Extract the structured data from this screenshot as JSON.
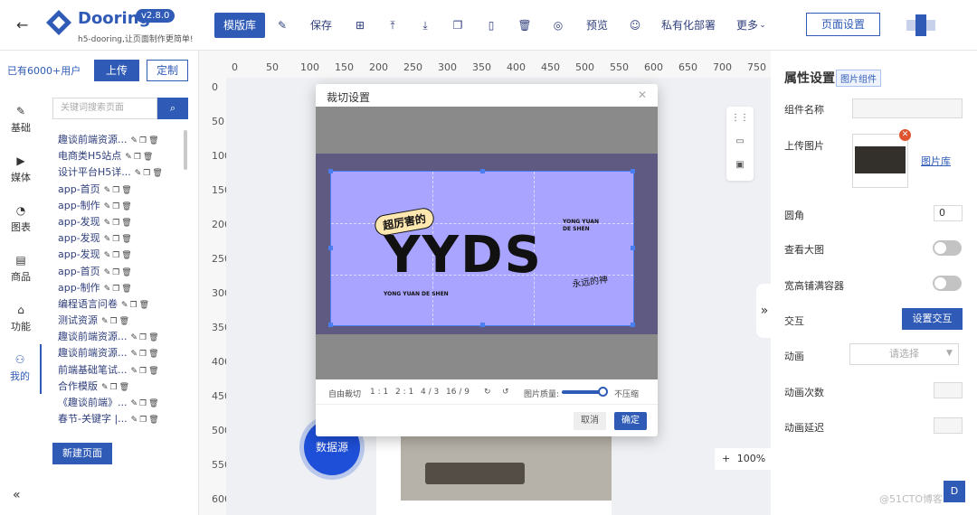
{
  "header": {
    "brand": "Dooring",
    "version": "v2.8.0",
    "slogan": "h5-dooring,让页面制作更简单!",
    "template_label": "模版库",
    "save_label": "保存",
    "preview_label": "预览",
    "private_deploy_label": "私有化部署",
    "more_label": "更多",
    "page_settings_label": "页面设置"
  },
  "left": {
    "users_text": "已有6000+用户",
    "upload_label": "上传",
    "custom_label": "定制",
    "search_placeholder": "关键词搜索页面",
    "nav": [
      {
        "label": "基础",
        "icon": "brush-icon"
      },
      {
        "label": "媒体",
        "icon": "play-icon"
      },
      {
        "label": "图表",
        "icon": "pie-chart-icon"
      },
      {
        "label": "商品",
        "icon": "shop-icon"
      },
      {
        "label": "功能",
        "icon": "function-icon"
      },
      {
        "label": "我的",
        "icon": "user-icon"
      }
    ],
    "pages": [
      "趣谈前端资源...",
      "电商类H5站点",
      "设计平台H5详...",
      "app-首页",
      "app-制作",
      "app-发现",
      "app-发现",
      "app-发现",
      "app-首页",
      "app-制作",
      "编程语言问卷",
      "测试资源",
      "趣谈前端资源...",
      "趣谈前端资源...",
      "前端基础笔试...",
      "合作模版",
      "《趣谈前端》...",
      "春节-关键字 |..."
    ],
    "new_page_label": "新建页面"
  },
  "ruler": {
    "top": [
      "0",
      "50",
      "100",
      "150",
      "200",
      "250",
      "300",
      "350",
      "400",
      "450",
      "500",
      "550",
      "600",
      "650",
      "700",
      "750"
    ],
    "left": [
      "0",
      "50",
      "100",
      "150",
      "200",
      "250",
      "300",
      "350",
      "400",
      "450",
      "500",
      "550",
      "600"
    ]
  },
  "canvas": {
    "data_source_label": "数据源",
    "zoom": "100%"
  },
  "modal": {
    "title": "裁切设置",
    "badge_text": "超厉害的",
    "big_text": "YYDS",
    "sub_tr": "YONG YUAN\nDE SHEN",
    "sub_bl": "YONG YUAN DE SHEN",
    "forever_text": "永远的神",
    "ratios": [
      "自由裁切",
      "1 : 1",
      "2 : 1",
      "4 / 3",
      "16 / 9"
    ],
    "quality_label": "图片质量:",
    "quality_value": 1.0,
    "no_compress_label": "不压缩",
    "cancel_label": "取消",
    "ok_label": "确定"
  },
  "right": {
    "title": "属性设置",
    "tag": "图片组件",
    "name_label": "组件名称",
    "upload_label": "上传图片",
    "gallery_link": "图片库",
    "radius_label": "圆角",
    "radius_value": "0",
    "big_view_label": "查看大图",
    "fill_label": "宽高铺满容器",
    "interact_label": "交互",
    "interact_btn": "设置交互",
    "anim_label": "动画",
    "anim_placeholder": "请选择",
    "anim_count_label": "动画次数",
    "anim_delay_label": "动画延迟",
    "watermark": "@51CTO博客"
  }
}
